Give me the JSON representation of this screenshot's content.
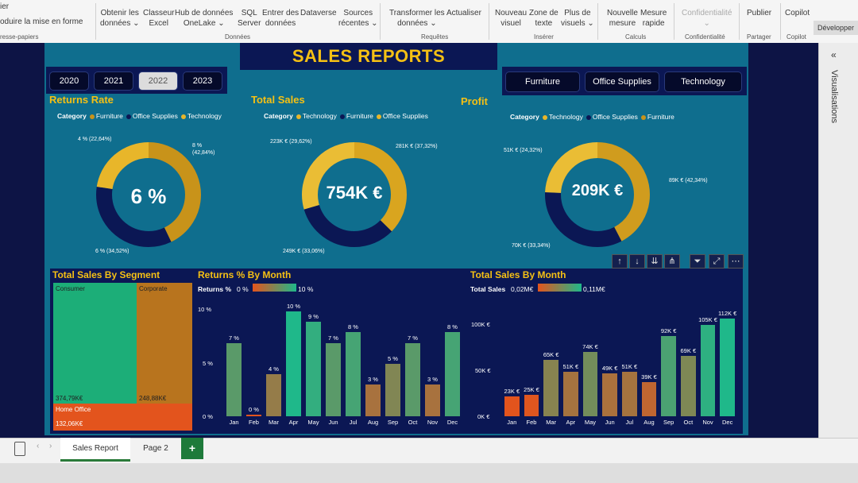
{
  "ribbon": {
    "items": [
      {
        "line1": "ier",
        "line2": "oduire la mise en forme"
      },
      {
        "line1": "Obtenir les",
        "line2": "données ⌄"
      },
      {
        "line1": "Classeur",
        "line2": "Excel"
      },
      {
        "line1": "Hub de données",
        "line2": "OneLake ⌄"
      },
      {
        "line1": "SQL",
        "line2": "Server"
      },
      {
        "line1": "Entrer des",
        "line2": "données"
      },
      {
        "line1": "Dataverse",
        "line2": ""
      },
      {
        "line1": "Sources",
        "line2": "récentes ⌄"
      },
      {
        "line1": "Transformer les",
        "line2": "données ⌄"
      },
      {
        "line1": "Actualiser",
        "line2": ""
      },
      {
        "line1": "Nouveau",
        "line2": "visuel"
      },
      {
        "line1": "Zone de",
        "line2": "texte"
      },
      {
        "line1": "Plus de",
        "line2": "visuels ⌄"
      },
      {
        "line1": "Nouvelle",
        "line2": "mesure"
      },
      {
        "line1": "Mesure",
        "line2": "rapide"
      },
      {
        "line1": "Confidentialité",
        "line2": "⌄"
      },
      {
        "line1": "Publier",
        "line2": ""
      },
      {
        "line1": "Copilot",
        "line2": ""
      }
    ],
    "groups": [
      "resse-papiers",
      "Données",
      "Requêtes",
      "Insérer",
      "Calculs",
      "Confidentialité",
      "Partager",
      "Copilot"
    ],
    "dev_tab": "Développer"
  },
  "report": {
    "title": "SALES REPORTS",
    "years": [
      "2020",
      "2021",
      "2022",
      "2023"
    ],
    "selected_year": "2022",
    "categories": [
      "Furniture",
      "Office Supplies",
      "Technology"
    ]
  },
  "donuts": {
    "returns": {
      "title": "Returns Rate",
      "legend_label": "Category",
      "legend": [
        "Furniture",
        "Office Supplies",
        "Technology"
      ],
      "center": "6 %",
      "labels": [
        "4 % (22,64%)",
        "8 %",
        "(42,84%)",
        "6 % (34,52%)"
      ],
      "shares": [
        42.84,
        34.52,
        22.64
      ]
    },
    "sales": {
      "title": "Total Sales",
      "legend_label": "Category",
      "legend": [
        "Technology",
        "Furniture",
        "Office Supplies"
      ],
      "center": "754K €",
      "labels": [
        "223K € (29,62%)",
        "281K € (37,32%)",
        "249K € (33,06%)"
      ],
      "shares": [
        37.32,
        33.06,
        29.62
      ]
    },
    "profit": {
      "title": "Profit",
      "legend_label": "Category",
      "legend": [
        "Technology",
        "Office Supplies",
        "Furniture"
      ],
      "center": "209K €",
      "labels": [
        "51K € (24,32%)",
        "89K € (42,34%)",
        "70K € (33,34%)"
      ],
      "shares": [
        42.34,
        33.34,
        24.32
      ]
    }
  },
  "segment": {
    "title": "Total Sales By Segment",
    "labels": [
      "Consumer",
      "Corporate",
      "Home Office"
    ],
    "values": [
      "374,79K€",
      "248,88K€",
      "132,06K€"
    ]
  },
  "chart_data": [
    {
      "type": "bar",
      "title": "Returns % By Month",
      "legend_label": "Returns %",
      "legend_min": "0 %",
      "legend_max": "10 %",
      "categories": [
        "Jan",
        "Feb",
        "Mar",
        "Apr",
        "May",
        "Jun",
        "Jul",
        "Aug",
        "Sep",
        "Oct",
        "Nov",
        "Dec"
      ],
      "values": [
        7,
        0,
        4,
        10,
        9,
        7,
        8,
        3,
        5,
        7,
        3,
        8
      ],
      "data_labels": [
        "7 %",
        "0 %",
        "4 %",
        "10 %",
        "9 %",
        "7 %",
        "8 %",
        "3 %",
        "5 %",
        "7 %",
        "3 %",
        "8 %"
      ],
      "yticks": [
        "10 %",
        "5 %",
        "0 %"
      ],
      "ylim": [
        0,
        10
      ]
    },
    {
      "type": "bar",
      "title": "Total Sales By Month",
      "legend_label": "Total Sales",
      "legend_min": "0,02M€",
      "legend_max": "0,11M€",
      "categories": [
        "Jan",
        "Feb",
        "Mar",
        "Apr",
        "May",
        "Jun",
        "Jul",
        "Aug",
        "Sep",
        "Oct",
        "Nov",
        "Dec"
      ],
      "values": [
        23,
        25,
        65,
        51,
        74,
        49,
        51,
        39,
        92,
        69,
        105,
        112
      ],
      "data_labels": [
        "23K €",
        "25K €",
        "65K €",
        "51K €",
        "74K €",
        "49K €",
        "51K €",
        "39K €",
        "92K €",
        "69K €",
        "105K €",
        "112K €"
      ],
      "yticks": [
        "100K €",
        "50K €",
        "0K €"
      ],
      "ylim": [
        0,
        120
      ]
    }
  ],
  "tabs": {
    "page1": "Sales Report",
    "page2": "Page 2",
    "add": "+"
  },
  "right_pane": {
    "label": "Visualisations"
  },
  "colors": {
    "gold": "#e8b62a",
    "navy": "#0b1754",
    "green": "#1fb88a",
    "orange": "#e0622a"
  }
}
